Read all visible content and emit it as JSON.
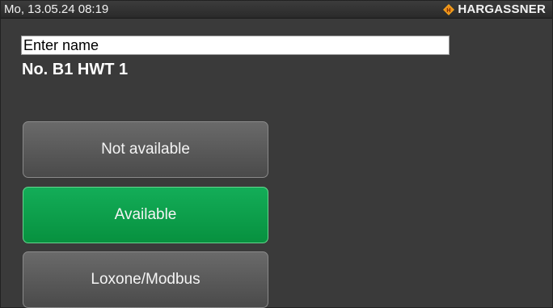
{
  "statusbar": {
    "datetime": "Mo, 13.05.24 08:19",
    "brand": "HARGASSNER",
    "brand_icon": "hargassner-logo-icon"
  },
  "name_field": {
    "placeholder": "Enter name",
    "value": ""
  },
  "device": {
    "name": "No. B1 HWT 1"
  },
  "options": [
    {
      "label": "Not available",
      "selected": false
    },
    {
      "label": "Available",
      "selected": true
    },
    {
      "label": "Loxone/Modbus",
      "selected": false
    }
  ],
  "colors": {
    "background": "#3a3a3a",
    "selected_button": "#0aa04b",
    "button": "#555555",
    "brand_icon": "#f4a21a"
  }
}
